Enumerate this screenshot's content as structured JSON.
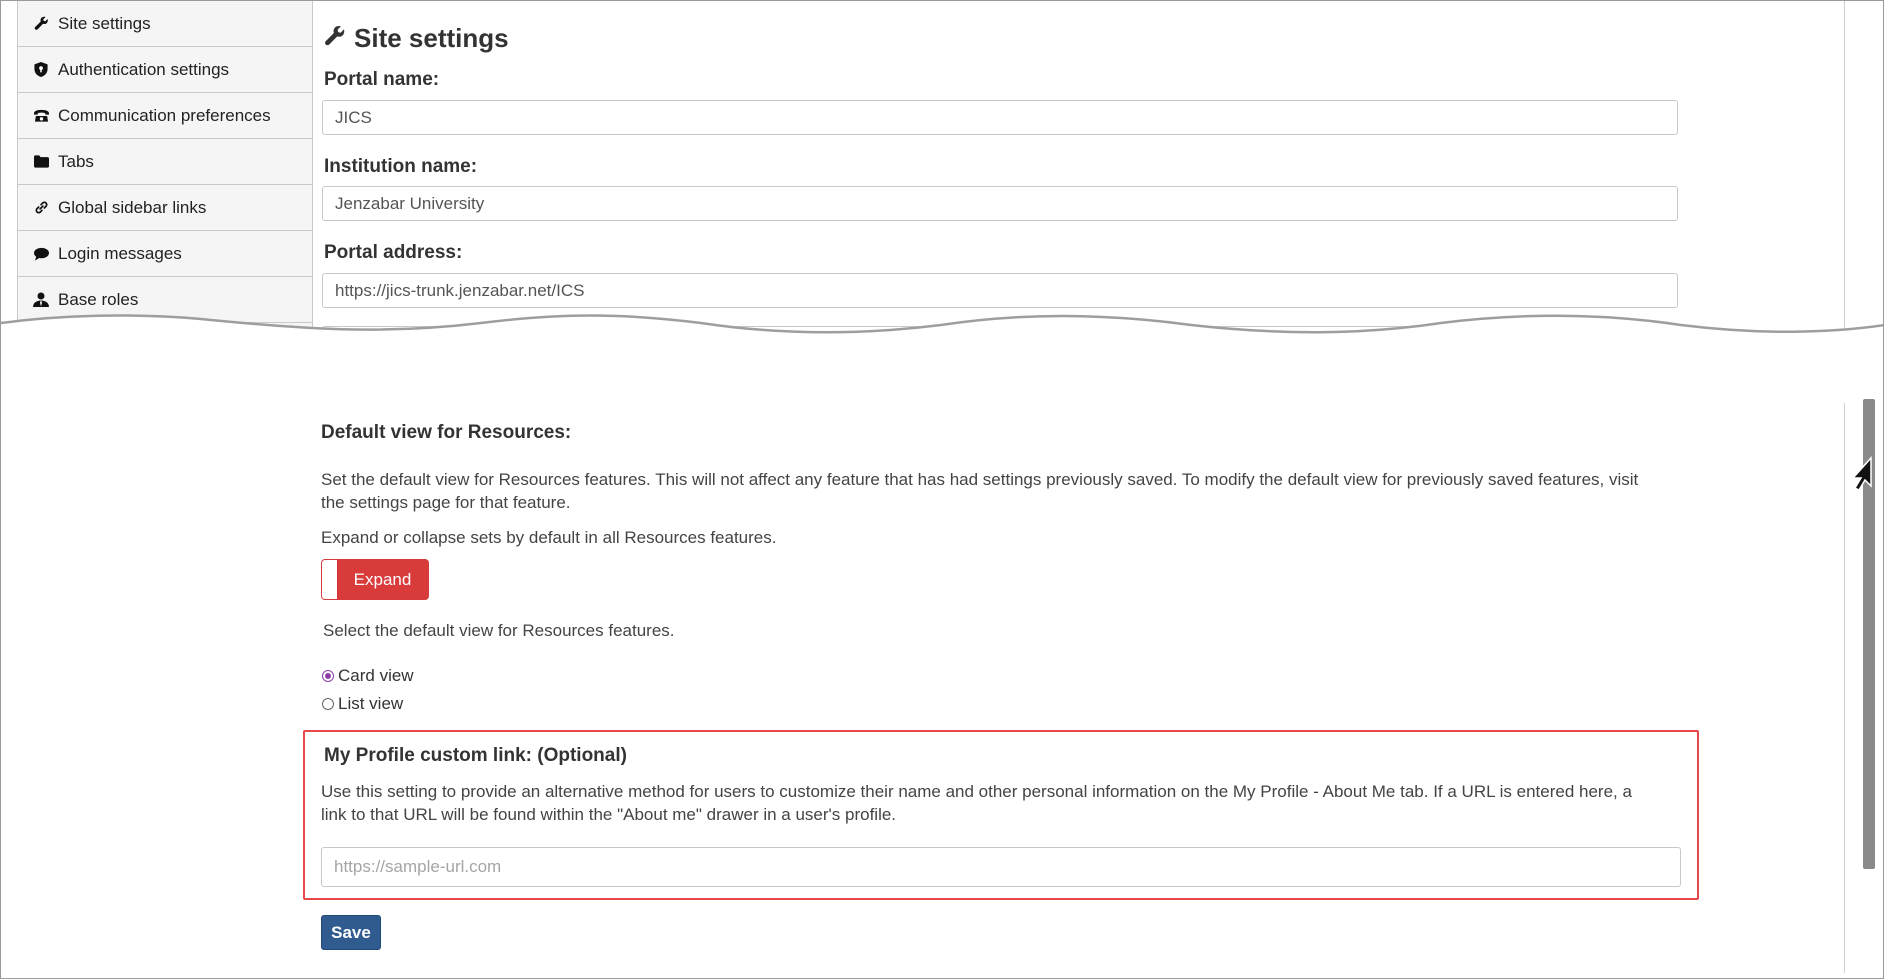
{
  "sidebar": {
    "items": [
      {
        "label": "Site settings",
        "icon": "wrench-icon"
      },
      {
        "label": "Authentication settings",
        "icon": "shield-icon"
      },
      {
        "label": "Communication preferences",
        "icon": "phone-icon"
      },
      {
        "label": "Tabs",
        "icon": "folder-icon"
      },
      {
        "label": "Global sidebar links",
        "icon": "link-icon"
      },
      {
        "label": "Login messages",
        "icon": "comment-icon"
      },
      {
        "label": "Base roles",
        "icon": "user-tie-icon"
      }
    ]
  },
  "site": {
    "title": "Site settings",
    "portal_name_label": "Portal name:",
    "portal_name_value": "JICS",
    "institution_label": "Institution name:",
    "institution_value": "Jenzabar University",
    "portal_address_label": "Portal address:",
    "portal_address_value": "https://jics-trunk.jenzabar.net/ICS"
  },
  "resources": {
    "title": "Default view for Resources:",
    "description": "Set the default view for Resources features. This will not affect any feature that has had settings previously saved. To modify the default view for previously saved features, visit the settings page for that feature.",
    "expand_prompt": "Expand or collapse sets by default in all Resources features.",
    "toggle_label": "Expand",
    "view_prompt": "Select the default view for Resources features.",
    "options": [
      {
        "label": "Card view",
        "selected": true
      },
      {
        "label": "List view",
        "selected": false
      }
    ]
  },
  "profile_link": {
    "title": "My Profile custom link: (Optional)",
    "description": "Use this setting to provide an alternative method for users to customize their name and other personal information on the My Profile - About Me tab. If a URL is entered here, a link to that URL will be found within the \"About me\" drawer in a user's profile.",
    "placeholder": "https://sample-url.com",
    "value": ""
  },
  "actions": {
    "save_label": "Save"
  },
  "colors": {
    "toggle_red": "#d93b3b",
    "highlight_red": "#e8474b",
    "save_blue": "#2f5b8f",
    "radio_purple": "#8b3fa8"
  }
}
